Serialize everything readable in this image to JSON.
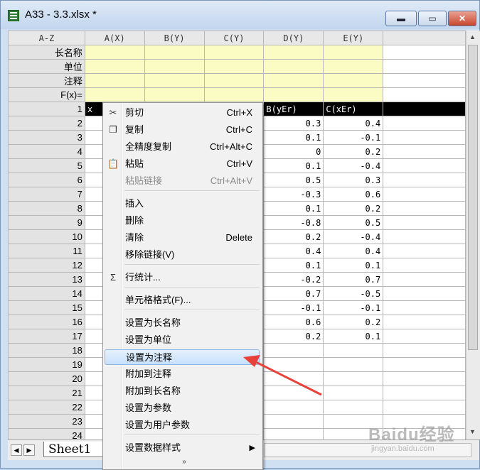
{
  "window": {
    "title": "A33 - 3.3.xlsx *",
    "min_symbol": "▬",
    "max_symbol": "▭",
    "close_symbol": "✕"
  },
  "corner_label": "A-Z",
  "columns": [
    {
      "label": "A(X)"
    },
    {
      "label": "B(Y)"
    },
    {
      "label": "C(Y)"
    },
    {
      "label": "D(Y)"
    },
    {
      "label": "E(Y)"
    }
  ],
  "meta_rows": [
    "长名称",
    "单位",
    "注释",
    "F(x)="
  ],
  "rows": [
    {
      "n": "1",
      "a": "x",
      "b": "",
      "c": "",
      "d": "B(yEr)",
      "e": "C(xEr)"
    },
    {
      "n": "2",
      "d": "0.3",
      "e": "0.4"
    },
    {
      "n": "3",
      "d": "0.1",
      "e": "-0.1"
    },
    {
      "n": "4",
      "d": "0",
      "e": "0.2"
    },
    {
      "n": "5",
      "d": "0.1",
      "e": "-0.4"
    },
    {
      "n": "6",
      "d": "0.5",
      "e": "0.3"
    },
    {
      "n": "7",
      "d": "-0.3",
      "e": "0.6"
    },
    {
      "n": "8",
      "d": "0.1",
      "e": "0.2"
    },
    {
      "n": "9",
      "d": "-0.8",
      "e": "0.5"
    },
    {
      "n": "10",
      "d": "0.2",
      "e": "-0.4"
    },
    {
      "n": "11",
      "d": "0.4",
      "e": "0.4"
    },
    {
      "n": "12",
      "d": "0.1",
      "e": "0.1"
    },
    {
      "n": "13",
      "d": "-0.2",
      "e": "0.7"
    },
    {
      "n": "14",
      "d": "0.7",
      "e": "-0.5"
    },
    {
      "n": "15",
      "d": "-0.1",
      "e": "-0.1"
    },
    {
      "n": "16",
      "d": "0.6",
      "e": "0.2"
    },
    {
      "n": "17",
      "d": "0.2",
      "e": "0.1"
    },
    {
      "n": "18",
      "d": "",
      "e": ""
    },
    {
      "n": "19",
      "d": "",
      "e": ""
    },
    {
      "n": "20",
      "d": "",
      "e": ""
    },
    {
      "n": "21",
      "d": "",
      "e": ""
    },
    {
      "n": "22",
      "d": "",
      "e": ""
    },
    {
      "n": "23",
      "d": "",
      "e": ""
    },
    {
      "n": "24",
      "d": "",
      "e": ""
    }
  ],
  "sheet_tab": "Sheet1",
  "context_menu": [
    {
      "label": "剪切",
      "shortcut": "Ctrl+X",
      "icon": "scissors-icon",
      "glyph": "✂"
    },
    {
      "label": "复制",
      "shortcut": "Ctrl+C",
      "icon": "copy-icon",
      "glyph": "❐"
    },
    {
      "label": "全精度复制",
      "shortcut": "Ctrl+Alt+C"
    },
    {
      "label": "粘贴",
      "shortcut": "Ctrl+V",
      "icon": "paste-icon",
      "glyph": "📋"
    },
    {
      "label": "粘贴链接",
      "shortcut": "Ctrl+Alt+V",
      "disabled": true
    },
    {
      "sep": true
    },
    {
      "label": "插入"
    },
    {
      "label": "删除"
    },
    {
      "label": "清除",
      "shortcut": "Delete"
    },
    {
      "label": "移除链接(V)"
    },
    {
      "sep": true
    },
    {
      "label": "行统计...",
      "icon": "sigma-icon",
      "glyph": "Σ"
    },
    {
      "sep": true
    },
    {
      "label": "单元格格式(F)..."
    },
    {
      "sep": true
    },
    {
      "label": "设置为长名称"
    },
    {
      "label": "设置为单位"
    },
    {
      "label": "设置为注释",
      "highlighted": true
    },
    {
      "label": "附加到注释"
    },
    {
      "label": "附加到长名称"
    },
    {
      "label": "设置为参数"
    },
    {
      "label": "设置为用户参数"
    },
    {
      "sep": true
    },
    {
      "label": "设置数据样式",
      "submenu": true
    }
  ],
  "menu_more_glyph": "»",
  "watermark": {
    "main": "Baidu经验",
    "sub": "jingyan.baidu.com"
  },
  "colors": {
    "highlight": "#c7e0fb",
    "meta_bg": "#fbfbc4",
    "arrow": "#e8413a"
  }
}
